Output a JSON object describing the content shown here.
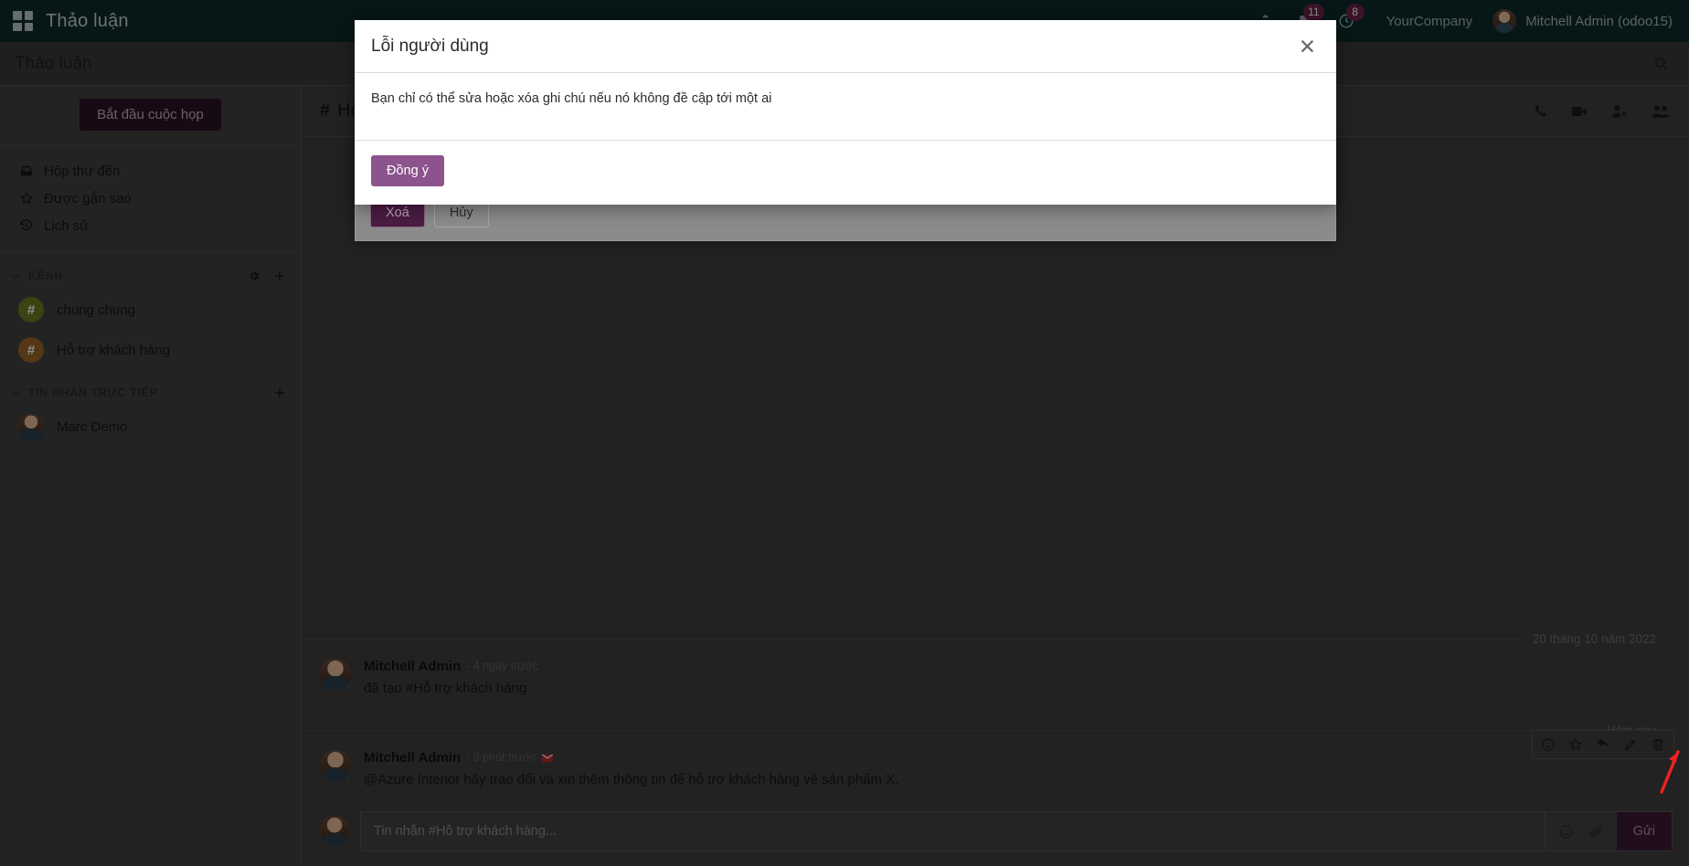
{
  "navbar": {
    "apps_icon": "apps-grid-icon",
    "brand": "Thảo luận",
    "icons": [
      {
        "name": "bug-icon",
        "badge": null
      },
      {
        "name": "messages-icon",
        "badge": "11"
      },
      {
        "name": "activities-clock-icon",
        "badge": "8"
      }
    ],
    "company": "YourCompany",
    "user": "Mitchell Admin (odoo15)"
  },
  "control_panel": {
    "title": "Thảo luận",
    "search_icon": "search-icon"
  },
  "sidebar": {
    "start_meeting": "Bắt đầu cuộc họp",
    "mailboxes": [
      {
        "icon": "inbox-icon",
        "label": "Hộp thư đến"
      },
      {
        "icon": "star-icon",
        "label": "Được gắn sao"
      },
      {
        "icon": "history-icon",
        "label": "Lịch sử"
      }
    ],
    "channels_section": {
      "title": "KÊNH",
      "gear_icon": "gear-icon",
      "add_icon": "plus-icon",
      "items": [
        {
          "label": "chung chung",
          "hash": "#",
          "color": "#6a7a22"
        },
        {
          "label": "Hỗ trợ khách hàng",
          "hash": "#",
          "color": "#9a6526"
        }
      ]
    },
    "dm_section": {
      "title": "TIN NHẮN TRỰC TIẾP",
      "add_icon": "plus-icon",
      "items": [
        {
          "label": "Marc Demo"
        }
      ]
    }
  },
  "channel": {
    "hash": "#",
    "name": "Hỗ trợ khách hàng",
    "actions": [
      {
        "name": "phone-icon"
      },
      {
        "name": "video-camera-icon"
      },
      {
        "name": "add-user-icon"
      },
      {
        "name": "members-icon"
      }
    ]
  },
  "thread": {
    "separators": {
      "older": "20 tháng 10 năm 2022",
      "today": "Hôm nay"
    },
    "messages": [
      {
        "author": "Mitchell Admin",
        "time": "- 4 ngày trước",
        "envelope": false,
        "text": "đã tạo #Hỗ trợ khách hàng"
      },
      {
        "author": "Mitchell Admin",
        "time": "- 3 phút trước",
        "envelope": true,
        "text": "@Azure Interior hãy trao đổi và xin thêm thông tin để hỗ trợ khách hàng về sản phẩm X."
      }
    ],
    "toolbar": [
      {
        "name": "add-reaction-icon"
      },
      {
        "name": "star-icon"
      },
      {
        "name": "reply-icon"
      },
      {
        "name": "edit-pencil-icon"
      },
      {
        "name": "delete-trash-icon"
      }
    ]
  },
  "composer": {
    "placeholder": "Tin nhắn #Hỗ trợ khách hàng...",
    "value": "",
    "emoji_icon": "emoji-icon",
    "attach_icon": "paperclip-icon",
    "send_label": "Gửi"
  },
  "dialog_back": {
    "delete_label": "Xoá",
    "cancel_label": "Hủy"
  },
  "dialog_front": {
    "title": "Lỗi người dùng",
    "close_icon": "close-icon",
    "message": "Bạn chỉ có thể sửa hoặc xóa ghi chú nếu nó không đề cập tới một ai",
    "ok_label": "Đồng ý"
  },
  "annotation": {
    "arrow_color": "#ee2222"
  },
  "colors": {
    "navbar_bg": "#0d2b2b",
    "accent_purple": "#8c538c",
    "badge_bg": "#6b2449",
    "dialog_bg": "#ffffff"
  }
}
